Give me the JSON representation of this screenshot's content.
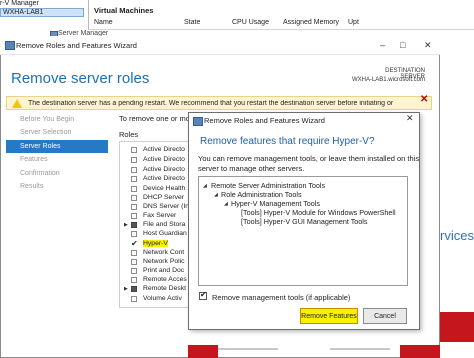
{
  "background": {
    "hyperv_manager": "r-V Manager",
    "hyperv_host": "WXHA-LAB1",
    "server_manager_tab": "Server Manager",
    "vm_panel_title": "Virtual Machines",
    "vm_columns": [
      "Name",
      "State",
      "CPU Usage",
      "Assigned Memory",
      "Upt"
    ],
    "services_fragment": "rvices"
  },
  "wizard": {
    "title": "Remove Roles and Features Wizard",
    "heading": "Remove server roles",
    "destination_label": "DESTINATION SERVER",
    "destination_value": "WXHA-LAB1.wicrosoft.com",
    "warning": "The destination server has a pending restart. We recommend that you restart the destination server before initiating or",
    "nav": [
      {
        "label": "Before You Begin",
        "dim": true
      },
      {
        "label": "Server Selection",
        "dim": true
      },
      {
        "label": "Server Roles",
        "selected": true
      },
      {
        "label": "Features",
        "dim": true
      },
      {
        "label": "Confirmation",
        "dim": true
      },
      {
        "label": "Results",
        "dim": true
      }
    ],
    "description": "To remove one or mo",
    "roles_label": "Roles",
    "roles": [
      {
        "label": "Active Directo",
        "state": "unchecked"
      },
      {
        "label": "Active Directo",
        "state": "unchecked"
      },
      {
        "label": "Active Directo",
        "state": "unchecked"
      },
      {
        "label": "Active Directo",
        "state": "unchecked"
      },
      {
        "label": "Device Health",
        "state": "unchecked"
      },
      {
        "label": "DHCP Server",
        "state": "unchecked"
      },
      {
        "label": "DNS Server (In",
        "state": "unchecked"
      },
      {
        "label": "Fax Server",
        "state": "unchecked"
      },
      {
        "label": "File and Stora",
        "state": "partial"
      },
      {
        "label": "Host Guardian",
        "state": "unchecked"
      },
      {
        "label": "Hyper-V",
        "state": "checked",
        "highlight": true
      },
      {
        "label": "Network Cont",
        "state": "unchecked"
      },
      {
        "label": "Network Polic",
        "state": "unchecked"
      },
      {
        "label": "Print and Doc",
        "state": "unchecked"
      },
      {
        "label": "Remote Acces",
        "state": "unchecked"
      },
      {
        "label": "Remote Deskt",
        "state": "partial"
      },
      {
        "label": "Volume Activ",
        "state": "unchecked"
      }
    ]
  },
  "modal": {
    "title": "Remove Roles and Features Wizard",
    "heading": "Remove features that require Hyper-V?",
    "body_line1": "You can remove management tools, or leave them installed on this",
    "body_line2": "server to manage other servers.",
    "tree": [
      "Remote Server Administration Tools",
      "Role Administration Tools",
      "Hyper-V Management Tools",
      "[Tools] Hyper-V Module for Windows PowerShell",
      "[Tools] Hyper-V GUI Management Tools"
    ],
    "checkbox_label": "Remove management tools (if applicable)",
    "primary_button": "Remove Features",
    "cancel_button": "Cancel"
  },
  "colors": {
    "accent_blue": "#2679c4",
    "heading_blue": "#1f6fb3",
    "highlight_yellow": "#f7f100",
    "warning_bg": "#fff4ce",
    "brand_red": "#c4161c"
  }
}
